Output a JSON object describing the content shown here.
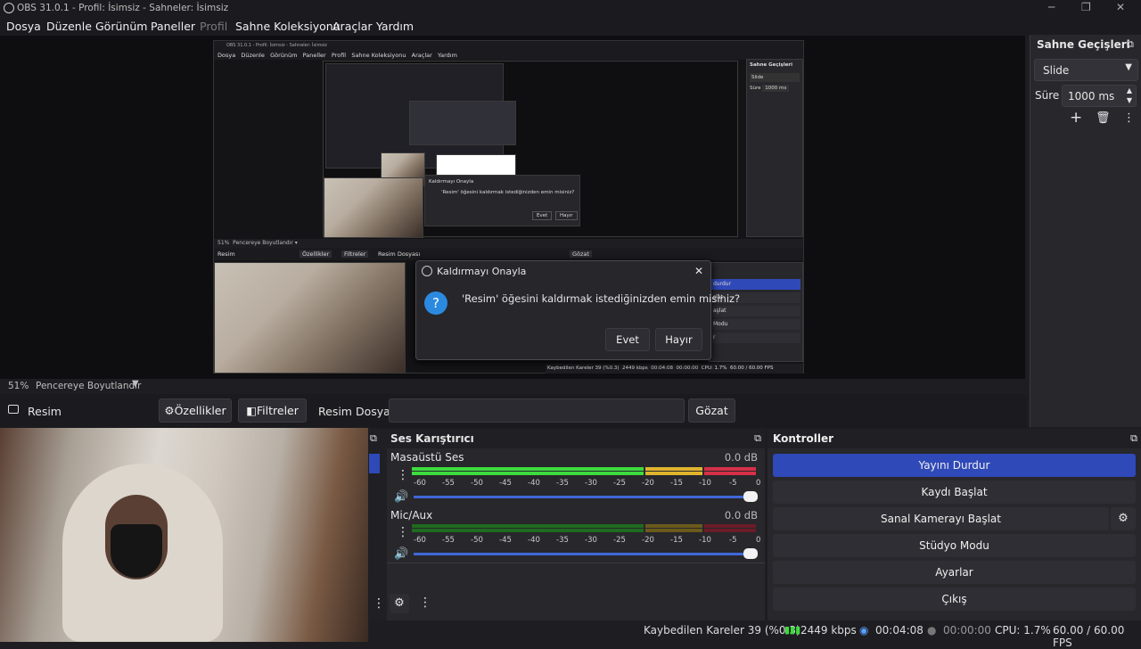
{
  "window": {
    "title": "OBS 31.0.1 - Profil: İsimsiz - Sahneler: İsimsiz",
    "minimize": "─",
    "maximize": "❐",
    "close": "✕"
  },
  "menu": [
    "Dosya",
    "Düzenle",
    "Görünüm",
    "Paneller",
    "Profil",
    "Sahne Koleksiyonu",
    "Araçlar",
    "Yardım"
  ],
  "preview": {
    "nested_menu": [
      "Dosya",
      "Düzenle",
      "Görünüm",
      "Paneller",
      "Profil",
      "Sahne Koleksiyonu",
      "Araçlar",
      "Yardım"
    ],
    "nested_title": "OBS 31.0.1 - Profil: İsimsiz - Sahneler: İsimsiz",
    "nested_transitions": "Sahne Geçişleri",
    "nested_slide": "Slide",
    "nested_sure": "Süre",
    "nested_ms": "1000 ms",
    "nested_zoom": "51%",
    "nested_fit": "Pencereye Boyutlandır",
    "nested_source": "Resim",
    "nested_props": "Özellikler",
    "nested_filters": "Filtreler",
    "nested_file": "Resim Dosyası",
    "nested_browse": "Gözat",
    "nested_dialog_title": "Kaldırmayı Onayla",
    "nested_dialog_msg": "'Resim' öğesini kaldırmak istediğinizden emin misiniz?",
    "nested_yes": "Evet",
    "nested_no": "Hayır",
    "nested_controls": [
      "durdur",
      "şlat",
      "aşlat",
      "Modu",
      "r"
    ],
    "nested_status": [
      "Kaybedilen Kareler 39 (%0.3)",
      "2449 kbps",
      "00:04:08",
      "00:00:00",
      "CPU: 1.7%",
      "60.00 / 60.00 FPS"
    ]
  },
  "dialog": {
    "title": "Kaldırmayı Onayla",
    "message": "'Resim' öğesini kaldırmak istediğinizden emin misiniz?",
    "yes": "Evet",
    "no": "Hayır",
    "close": "✕"
  },
  "zoom": {
    "percent": "51%",
    "fit": "Pencereye Boyutlandır"
  },
  "source": {
    "name": "Resim",
    "props": "Özellikler",
    "filters": "Filtreler",
    "file_label": "Resim Dosyası",
    "file_value": "",
    "browse": "Gözat"
  },
  "transitions": {
    "title": "Sahne Geçişleri",
    "type": "Slide",
    "duration_label": "Süre",
    "duration": "1000 ms"
  },
  "mixer": {
    "title": "Ses Karıştırıcı",
    "ticks": [
      "-60",
      "-55",
      "-50",
      "-45",
      "-40",
      "-35",
      "-30",
      "-25",
      "-20",
      "-15",
      "-10",
      "-5",
      "0"
    ],
    "channels": [
      {
        "name": "Masaüstü Ses",
        "db": "0.0 dB",
        "level": 1.0,
        "volume": 1.0
      },
      {
        "name": "Mic/Aux",
        "db": "0.0 dB",
        "level": 0.0,
        "volume": 1.0
      }
    ]
  },
  "controls": {
    "title": "Kontroller",
    "buttons": [
      "Yayını Durdur",
      "Kaydı Başlat",
      "Sanal Kamerayı Başlat",
      "Stüdyo Modu",
      "Ayarlar",
      "Çıkış"
    ],
    "active_color": "#2f49b8"
  },
  "status": {
    "dropped": "Kaybedilen Kareler 39 (%0.3)",
    "bitrate": "2449 kbps",
    "stream_time": "00:04:08",
    "rec_time": "00:00:00",
    "cpu": "CPU: 1.7%",
    "fps": "60.00 / 60.00 FPS"
  },
  "colors": {
    "meter_green": "#3ddc3d",
    "meter_yellow": "#e0b52e",
    "meter_red": "#d63048",
    "slider": "#3f68d8"
  }
}
